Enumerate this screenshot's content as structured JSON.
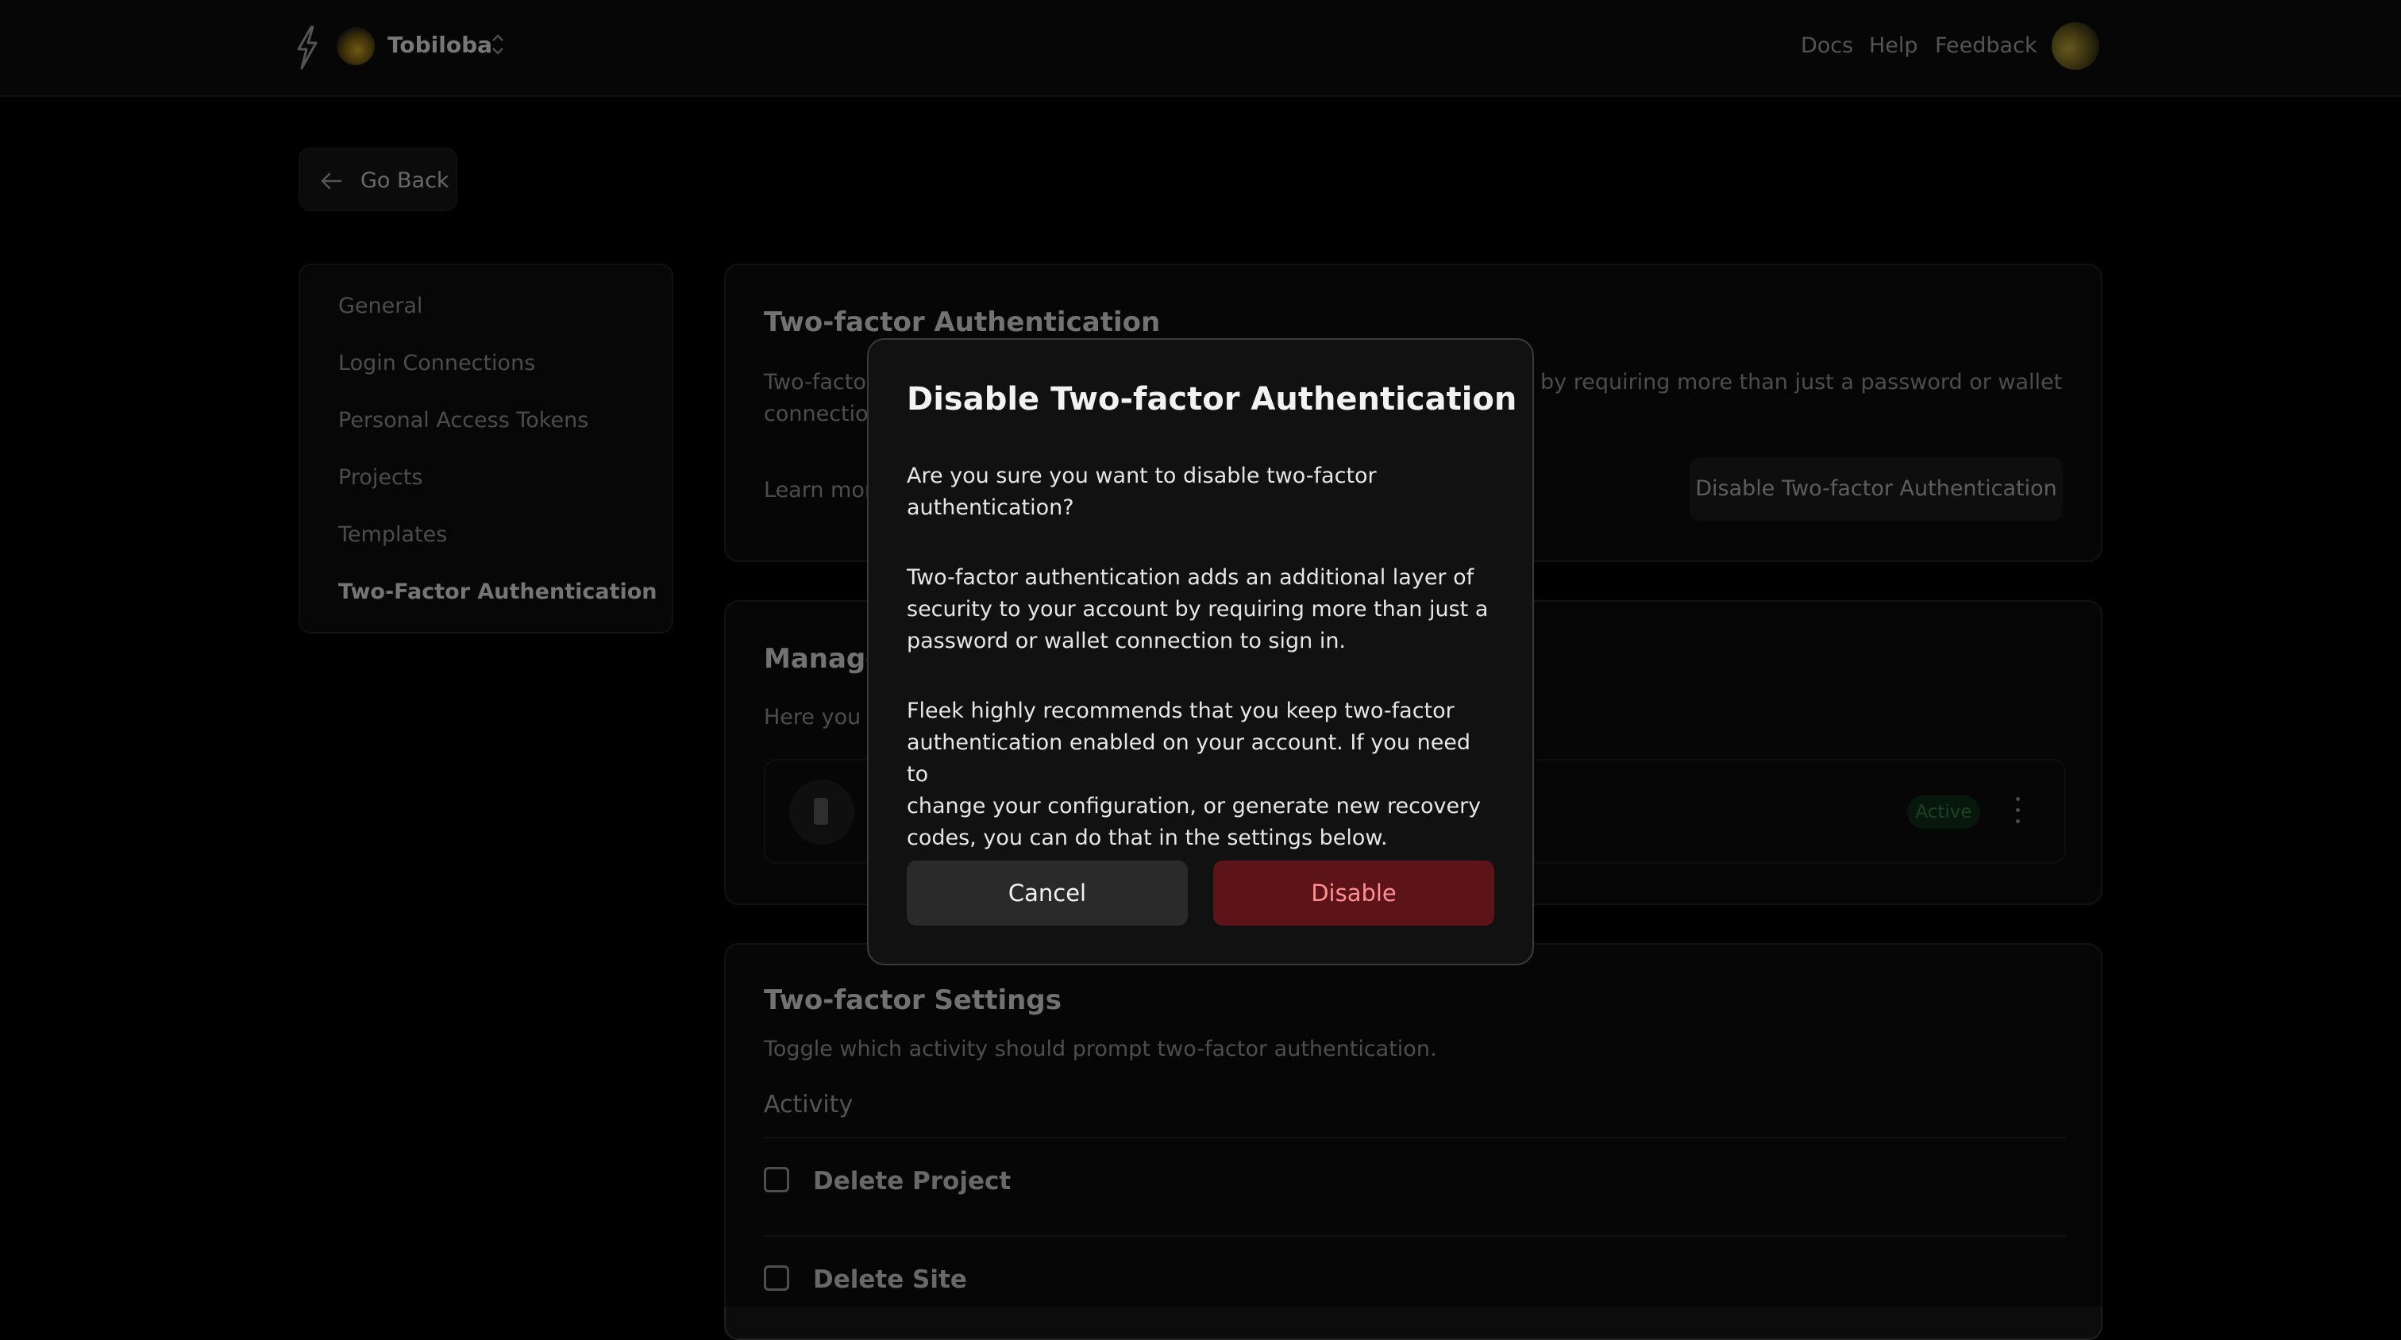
{
  "header": {
    "logo_icon": "bolt-logo-icon",
    "team_name": "Tobiloba",
    "team_switch_icon": "chevron-up-down-icon",
    "nav": [
      "Docs",
      "Help",
      "Feedback"
    ],
    "avatar_icon": "user-avatar"
  },
  "go_back": {
    "label": "Go Back",
    "icon": "arrow-left-icon"
  },
  "sidebar": {
    "items": [
      {
        "label": "General"
      },
      {
        "label": "Login Connections"
      },
      {
        "label": "Personal Access Tokens"
      },
      {
        "label": "Projects"
      },
      {
        "label": "Templates"
      },
      {
        "label": "Two-Factor Authentication",
        "active": true
      }
    ]
  },
  "auth_card": {
    "title": "Two-factor Authentication",
    "desc_left_1": "Two-factor",
    "desc_right_1": "by requiring more than just a password or wallet",
    "desc_left_2": "connection",
    "learn_more": "Learn more",
    "disable_button": "Disable Two-factor Authentication"
  },
  "manage_card": {
    "title": "Manage",
    "desc": "Here you c",
    "device_status": "Active",
    "device_icon": "phone-icon",
    "menu_icon": "kebab-menu-icon"
  },
  "settings_card": {
    "title": "Two-factor Settings",
    "desc": "Toggle which activity should prompt two-factor authentication.",
    "activity_label": "Activity",
    "activities": [
      {
        "label": "Delete Project",
        "checked": false
      },
      {
        "label": "Delete Site",
        "checked": false
      }
    ]
  },
  "modal": {
    "title": "Disable Two-factor Authentication",
    "p1_l1": "Are you sure you want to disable two-factor",
    "p1_l2": "authentication?",
    "p2_l1": "Two-factor authentication adds an additional layer of",
    "p2_l2": "security to your account by requiring more than just a",
    "p2_l3": "password or wallet connection to sign in.",
    "p3_l1": "Fleek highly recommends that you keep two-factor",
    "p3_l2": "authentication enabled on your account. If you need to",
    "p3_l3": "change your configuration, or generate new recovery",
    "p3_l4": "codes, you can do that in the settings below.",
    "cancel": "Cancel",
    "disable": "Disable"
  },
  "colors": {
    "background": "#000000",
    "danger_bg": "#5c1418",
    "danger_text": "#ff8f91",
    "success_text": "#2f7a3e"
  }
}
